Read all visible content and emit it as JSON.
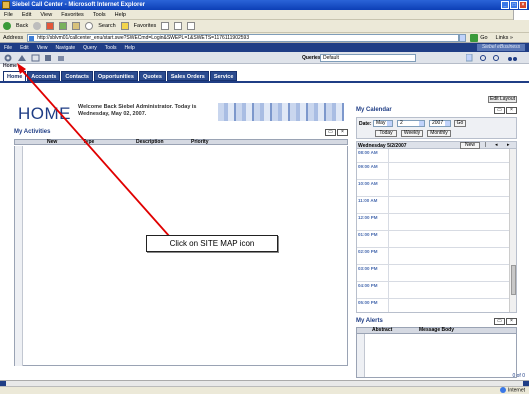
{
  "browser": {
    "title": "Siebel Call Center - Microsoft Internet Explorer",
    "menu": [
      "File",
      "Edit",
      "View",
      "Favorites",
      "Tools",
      "Help"
    ],
    "toolbar": {
      "back": "Back",
      "search": "Search",
      "favorites": "Favorites"
    },
    "address_label": "Address",
    "address_url": "http://sblvm01/callcenter_enu/start.swe?SWECmd=Login&SWEPL=1&SWETS=1176111902593",
    "go_label": "Go",
    "links_label": "Links »",
    "status_zone": "Internet"
  },
  "app": {
    "menu": [
      "File",
      "Edit",
      "View",
      "Navigate",
      "Query",
      "Tools",
      "Help"
    ],
    "logo": "Siebel eBusiness",
    "queries_label": "Queries:",
    "queries_value": "Default",
    "home_link": "Home",
    "tabs": [
      "Home",
      "Accounts",
      "Contacts",
      "Opportunities",
      "Quotes",
      "Sales Orders",
      "Service"
    ],
    "active_tab": "Home"
  },
  "home": {
    "title": "HOME",
    "welcome": "Welcome Back Siebel Administrator. Today is Wednesday, May 02, 2007."
  },
  "activities": {
    "title": "My Activities",
    "columns": [
      "New",
      "Type",
      "Description",
      "Priority"
    ]
  },
  "calendar": {
    "edit_layout": "Edit Layout",
    "title": "My Calendar",
    "date_label": "Date:",
    "month": "May",
    "day": "2",
    "year": "2007",
    "go": "Go",
    "views": [
      "Today",
      "Weekly",
      "Monthly"
    ],
    "day_header": "Wednesday 5/2/2007",
    "new_button": "New",
    "slots": [
      "08:00 AM",
      "09:00 AM",
      "10:00 AM",
      "11:00 AM",
      "12:00 PM",
      "01:00 PM",
      "02:00 PM",
      "03:00 PM",
      "04:00 PM",
      "05:00 PM"
    ]
  },
  "alerts": {
    "title": "My Alerts",
    "columns": [
      "Abstract",
      "Message Body"
    ]
  },
  "pager": "0 of 0",
  "callout": "Click on SITE MAP icon",
  "colors": {
    "app_blue": "#1f3d85",
    "arrow": "#e00000",
    "ie_title": "#0c3fb6"
  }
}
